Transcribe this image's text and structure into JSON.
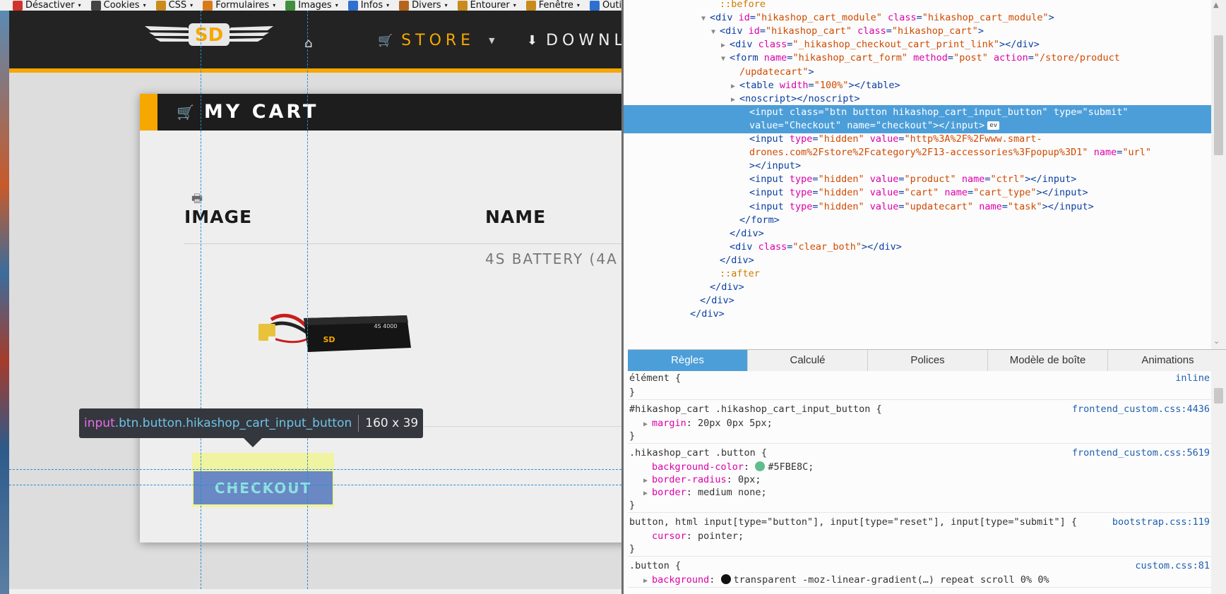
{
  "toolbar": {
    "items": [
      {
        "label": "Désactiver",
        "icon": "no-entry-icon",
        "color": "#d0342c"
      },
      {
        "label": "Cookies",
        "icon": "person-icon",
        "color": "#444444"
      },
      {
        "label": "CSS",
        "icon": "pencil-icon",
        "color": "#c98b1c"
      },
      {
        "label": "Formulaires",
        "icon": "form-icon",
        "color": "#d97a1a"
      },
      {
        "label": "Images",
        "icon": "image-icon",
        "color": "#3f8f3f"
      },
      {
        "label": "Infos",
        "icon": "info-icon",
        "color": "#2f6fd0"
      },
      {
        "label": "Divers",
        "icon": "box-icon",
        "color": "#b5651d"
      },
      {
        "label": "Entourer",
        "icon": "pen-icon",
        "color": "#c88a1c"
      },
      {
        "label": "Fenêtre",
        "icon": "ruler-icon",
        "color": "#c98b1c"
      },
      {
        "label": "Outi",
        "icon": "tools-icon",
        "color": "#2f6fd0"
      }
    ],
    "caret": "▾"
  },
  "site": {
    "nav": {
      "logo_text": "SD",
      "home_icon": "⌂",
      "store_icon": "🛒",
      "store_label": "STORE",
      "store_caret": "▼",
      "download_icon": "⬇",
      "download_label": "DOWNLO"
    },
    "cart": {
      "title_icon": "🛒",
      "title": "MY CART",
      "print_icon": "🖶",
      "col_image": "IMAGE",
      "col_name": "NAME",
      "product_name": "4S BATTERY (4A",
      "battery_label": "4S 4000",
      "checkout_label": "CHECKOUT"
    },
    "tooltip": {
      "tag": "input",
      "classes": ".btn.button.hikashop_cart_input_button",
      "dimensions": "160 x 39"
    }
  },
  "devtools": {
    "markup": [
      {
        "indent": 11,
        "twisty": "",
        "parts": [
          [
            "pseudo",
            "::before"
          ]
        ]
      },
      {
        "indent": 10,
        "twisty": "▼",
        "parts": [
          [
            "tag",
            "<div "
          ],
          [
            "attr",
            "id"
          ],
          [
            "tag",
            "="
          ],
          [
            "val",
            "\"hikashop_cart_module\""
          ],
          [
            "tag",
            " "
          ],
          [
            "attr",
            "class"
          ],
          [
            "tag",
            "="
          ],
          [
            "val",
            "\"hikashop_cart_module\""
          ],
          [
            "tag",
            ">"
          ]
        ]
      },
      {
        "indent": 11,
        "twisty": "▼",
        "parts": [
          [
            "tag",
            "<div "
          ],
          [
            "attr",
            "id"
          ],
          [
            "tag",
            "="
          ],
          [
            "val",
            "\"hikashop_cart\""
          ],
          [
            "tag",
            " "
          ],
          [
            "attr",
            "class"
          ],
          [
            "tag",
            "="
          ],
          [
            "val",
            "\"hikashop_cart\""
          ],
          [
            "tag",
            ">"
          ]
        ]
      },
      {
        "indent": 12,
        "twisty": "▶",
        "parts": [
          [
            "tag",
            "<div "
          ],
          [
            "attr",
            "class"
          ],
          [
            "tag",
            "="
          ],
          [
            "val",
            "\"_hikashop_checkout_cart_print_link\""
          ],
          [
            "tag",
            "></div>"
          ]
        ]
      },
      {
        "indent": 12,
        "twisty": "▼",
        "parts": [
          [
            "tag",
            "<form "
          ],
          [
            "attr",
            "name"
          ],
          [
            "tag",
            "="
          ],
          [
            "val",
            "\"hikashop_cart_form\""
          ],
          [
            "tag",
            " "
          ],
          [
            "attr",
            "method"
          ],
          [
            "tag",
            "="
          ],
          [
            "val",
            "\"post\""
          ],
          [
            "tag",
            " "
          ],
          [
            "attr",
            "action"
          ],
          [
            "tag",
            "="
          ],
          [
            "val",
            "\"/store/product"
          ]
        ]
      },
      {
        "indent": 13,
        "twisty": "",
        "parts": [
          [
            "val",
            "/updatecart\""
          ],
          [
            "tag",
            ">"
          ]
        ]
      },
      {
        "indent": 13,
        "twisty": "▶",
        "parts": [
          [
            "tag",
            "<table "
          ],
          [
            "attr",
            "width"
          ],
          [
            "tag",
            "="
          ],
          [
            "val",
            "\"100%\""
          ],
          [
            "tag",
            "></table>"
          ]
        ]
      },
      {
        "indent": 13,
        "twisty": "▶",
        "parts": [
          [
            "tag",
            "<noscript></noscript>"
          ]
        ]
      },
      {
        "indent": 14,
        "twisty": "",
        "selected": true,
        "parts": [
          [
            "tag",
            "<input "
          ],
          [
            "attr",
            "class"
          ],
          [
            "tag",
            "="
          ],
          [
            "val",
            "\"btn button hikashop_cart_input_button\""
          ],
          [
            "tag",
            " "
          ],
          [
            "attr",
            "type"
          ],
          [
            "tag",
            "="
          ],
          [
            "val",
            "\"submit\""
          ]
        ]
      },
      {
        "indent": 14,
        "twisty": "",
        "selected": true,
        "ev": "ev",
        "parts": [
          [
            "attr",
            "value"
          ],
          [
            "tag",
            "="
          ],
          [
            "val",
            "\"Checkout\""
          ],
          [
            "tag",
            " "
          ],
          [
            "attr",
            "name"
          ],
          [
            "tag",
            "="
          ],
          [
            "val",
            "\"checkout\""
          ],
          [
            "tag",
            "></input>"
          ]
        ]
      },
      {
        "indent": 14,
        "twisty": "",
        "parts": [
          [
            "tag",
            "<input "
          ],
          [
            "attr",
            "type"
          ],
          [
            "tag",
            "="
          ],
          [
            "val",
            "\"hidden\""
          ],
          [
            "tag",
            " "
          ],
          [
            "attr",
            "value"
          ],
          [
            "tag",
            "="
          ],
          [
            "val",
            "\"http%3A%2F%2Fwww.smart-"
          ]
        ]
      },
      {
        "indent": 14,
        "twisty": "",
        "parts": [
          [
            "val",
            "drones.com%2Fstore%2Fcategory%2F13-accessories%3Fpopup%3D1\""
          ],
          [
            "tag",
            " "
          ],
          [
            "attr",
            "name"
          ],
          [
            "tag",
            "="
          ],
          [
            "val",
            "\"url\""
          ]
        ]
      },
      {
        "indent": 14,
        "twisty": "",
        "parts": [
          [
            "tag",
            "></input>"
          ]
        ]
      },
      {
        "indent": 14,
        "twisty": "",
        "parts": [
          [
            "tag",
            "<input "
          ],
          [
            "attr",
            "type"
          ],
          [
            "tag",
            "="
          ],
          [
            "val",
            "\"hidden\""
          ],
          [
            "tag",
            " "
          ],
          [
            "attr",
            "value"
          ],
          [
            "tag",
            "="
          ],
          [
            "val",
            "\"product\""
          ],
          [
            "tag",
            " "
          ],
          [
            "attr",
            "name"
          ],
          [
            "tag",
            "="
          ],
          [
            "val",
            "\"ctrl\""
          ],
          [
            "tag",
            "></input>"
          ]
        ]
      },
      {
        "indent": 14,
        "twisty": "",
        "parts": [
          [
            "tag",
            "<input "
          ],
          [
            "attr",
            "type"
          ],
          [
            "tag",
            "="
          ],
          [
            "val",
            "\"hidden\""
          ],
          [
            "tag",
            " "
          ],
          [
            "attr",
            "value"
          ],
          [
            "tag",
            "="
          ],
          [
            "val",
            "\"cart\""
          ],
          [
            "tag",
            " "
          ],
          [
            "attr",
            "name"
          ],
          [
            "tag",
            "="
          ],
          [
            "val",
            "\"cart_type\""
          ],
          [
            "tag",
            "></input>"
          ]
        ]
      },
      {
        "indent": 14,
        "twisty": "",
        "parts": [
          [
            "tag",
            "<input "
          ],
          [
            "attr",
            "type"
          ],
          [
            "tag",
            "="
          ],
          [
            "val",
            "\"hidden\""
          ],
          [
            "tag",
            " "
          ],
          [
            "attr",
            "value"
          ],
          [
            "tag",
            "="
          ],
          [
            "val",
            "\"updatecart\""
          ],
          [
            "tag",
            " "
          ],
          [
            "attr",
            "name"
          ],
          [
            "tag",
            "="
          ],
          [
            "val",
            "\"task\""
          ],
          [
            "tag",
            "></input>"
          ]
        ]
      },
      {
        "indent": 13,
        "twisty": "",
        "parts": [
          [
            "tag",
            "</form>"
          ]
        ]
      },
      {
        "indent": 12,
        "twisty": "",
        "parts": [
          [
            "tag",
            "</div>"
          ]
        ]
      },
      {
        "indent": 12,
        "twisty": "",
        "parts": [
          [
            "tag",
            "<div "
          ],
          [
            "attr",
            "class"
          ],
          [
            "tag",
            "="
          ],
          [
            "val",
            "\"clear_both\""
          ],
          [
            "tag",
            "></div>"
          ]
        ]
      },
      {
        "indent": 11,
        "twisty": "",
        "parts": [
          [
            "tag",
            "</div>"
          ]
        ]
      },
      {
        "indent": 11,
        "twisty": "",
        "parts": [
          [
            "pseudo",
            "::after"
          ]
        ]
      },
      {
        "indent": 10,
        "twisty": "",
        "parts": [
          [
            "tag",
            "</div>"
          ]
        ]
      },
      {
        "indent": 9,
        "twisty": "",
        "parts": [
          [
            "tag",
            "</div>"
          ]
        ]
      },
      {
        "indent": 8,
        "twisty": "",
        "parts": [
          [
            "tag",
            "</div>"
          ]
        ]
      }
    ],
    "tabs": [
      "Règles",
      "Calculé",
      "Polices",
      "Modèle de boîte",
      "Animations"
    ],
    "active_tab": 0,
    "rules": [
      {
        "selector": "élément {",
        "source": "inline",
        "props": [],
        "close": "}"
      },
      {
        "selector": "#hikashop_cart .hikashop_cart_input_button {",
        "source": "frontend_custom.css:4436",
        "props": [
          {
            "name": "margin",
            "value": "20px 0px 5px;",
            "expand": true
          }
        ],
        "close": "}"
      },
      {
        "selector": ".hikashop_cart .button {",
        "source": "frontend_custom.css:5619",
        "props": [
          {
            "name": "background-color",
            "value": "#5FBE8C;",
            "swatch": "#5FBE8C"
          },
          {
            "name": "border-radius",
            "value": "0px;",
            "expand": true
          },
          {
            "name": "border",
            "value": "medium none;",
            "expand": true
          }
        ],
        "close": "}"
      },
      {
        "selector": "button, html input[type=\"button\"], input[type=\"reset\"], input[type=\"submit\"] {",
        "source": "bootstrap.css:119",
        "props": [
          {
            "name": "cursor",
            "value": "pointer;"
          }
        ],
        "close": "}"
      },
      {
        "selector": ".button {",
        "source": "custom.css:81",
        "props": [
          {
            "name": "background",
            "value": "transparent -moz-linear-gradient(…) repeat scroll 0% 0%",
            "expand": true,
            "swatch": "#111111"
          }
        ],
        "close": ""
      }
    ]
  }
}
